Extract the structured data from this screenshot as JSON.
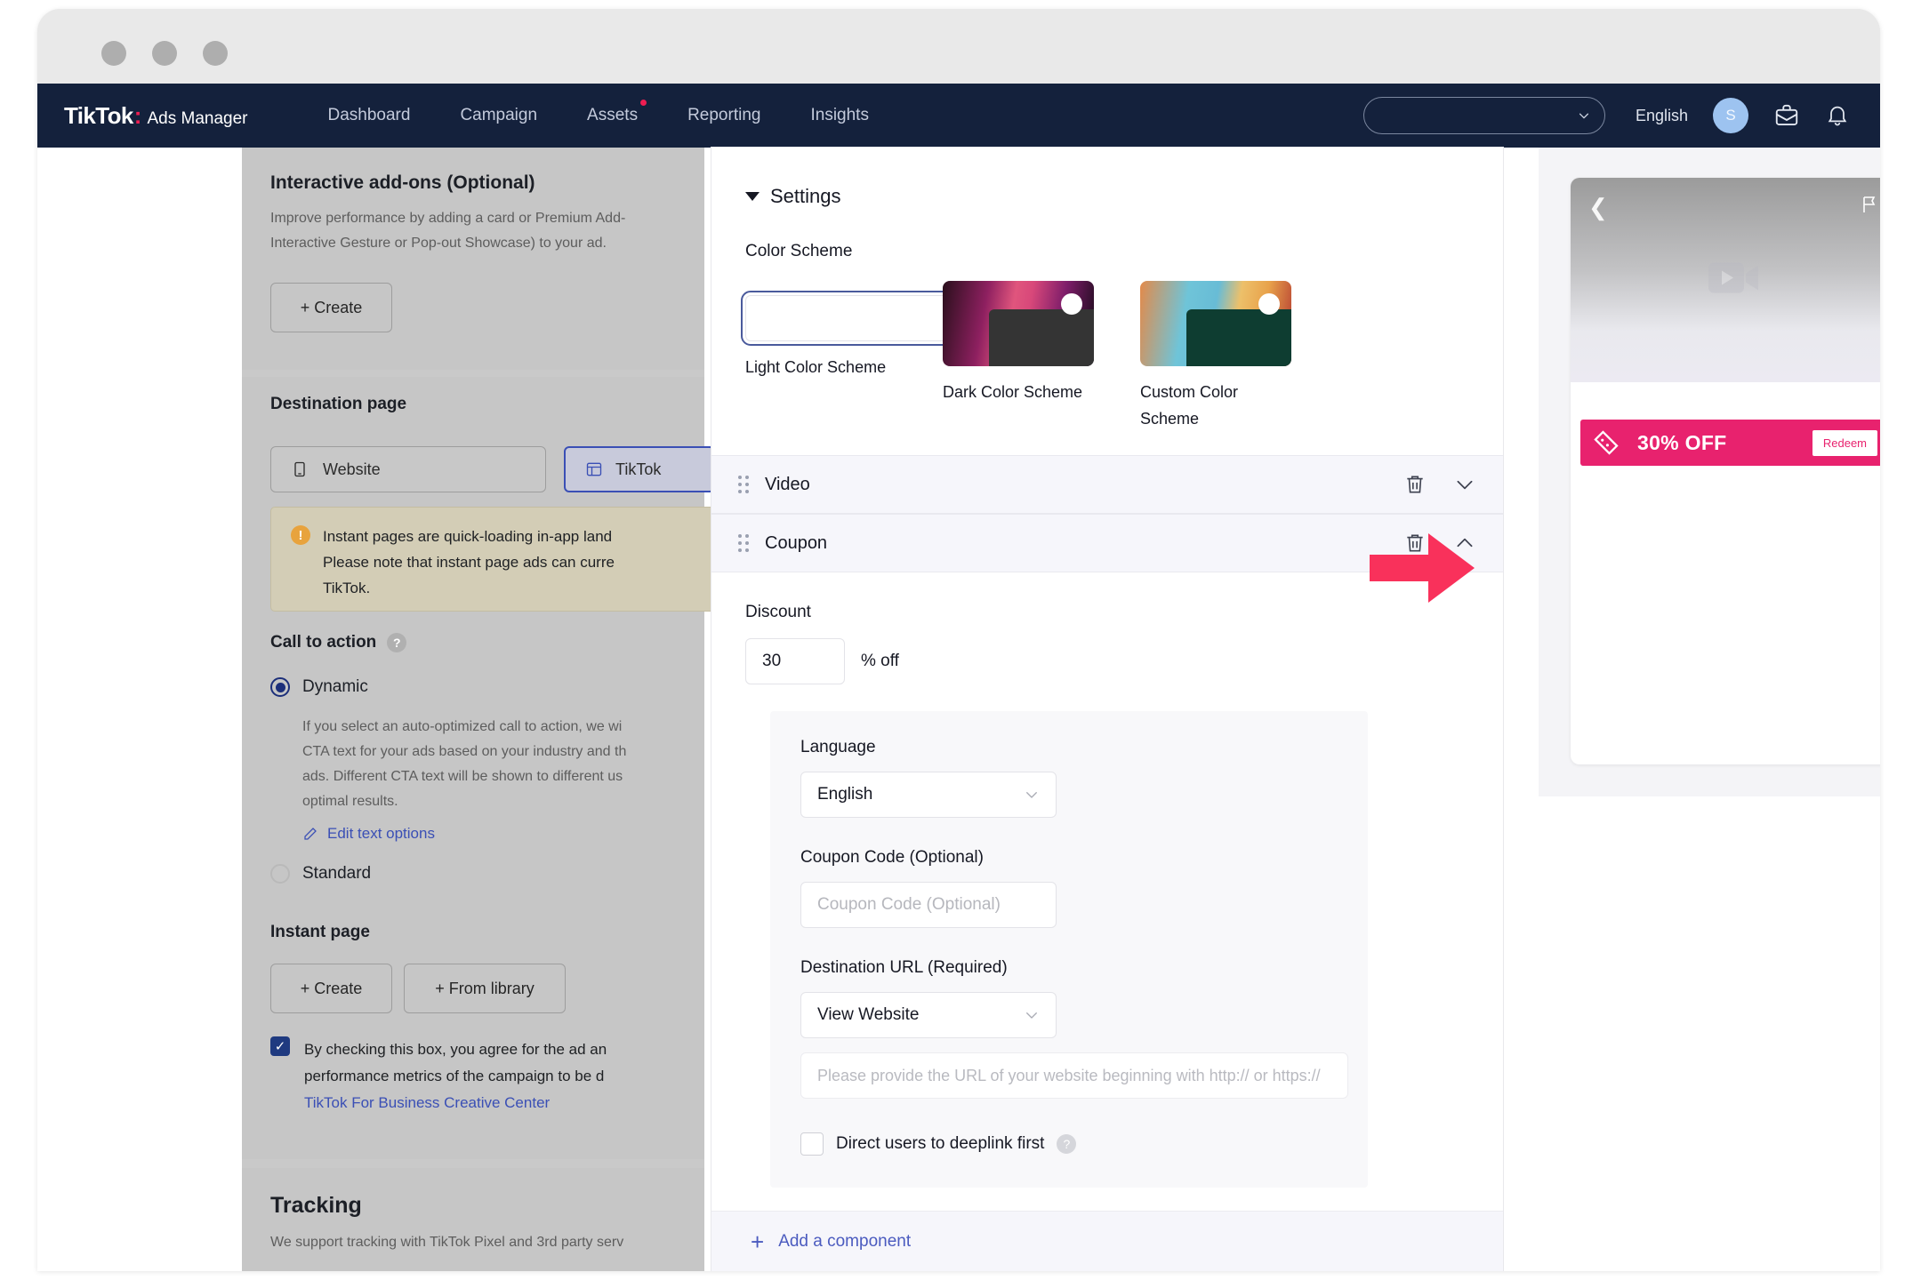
{
  "window": {
    "dots": [
      "close",
      "minimize",
      "maximize"
    ]
  },
  "nav": {
    "brand_name": "TikTok",
    "brand_colon": ":",
    "brand_suffix": "Ads Manager",
    "links": [
      {
        "label": "Dashboard",
        "badge": false
      },
      {
        "label": "Campaign",
        "badge": false
      },
      {
        "label": "Assets",
        "badge": true
      },
      {
        "label": "Reporting",
        "badge": false
      },
      {
        "label": "Insights",
        "badge": false
      }
    ],
    "account_selector_value": "",
    "language": "English",
    "avatar_initial": "S",
    "icons": [
      "chevron-down-icon",
      "briefcase-icon",
      "bell-icon"
    ]
  },
  "left_form": {
    "addons_title": "Interactive add-ons (Optional)",
    "addons_desc_line1": "Improve performance by adding a card or Premium Add-",
    "addons_desc_line2": "Interactive Gesture or Pop-out Showcase) to your ad.",
    "addons_create": "+ Create",
    "destination_title": "Destination page",
    "dest_website": "Website",
    "dest_tiktok": "TikTok",
    "alert_line1": "Instant pages are quick-loading in-app land",
    "alert_line2": "Please note that instant page ads can curre",
    "alert_line3": "TikTok.",
    "cta_title": "Call to action",
    "cta_dynamic": "Dynamic",
    "cta_desc_line1": "If you select an auto-optimized call to action, we wi",
    "cta_desc_line2": "CTA text for your ads based on your industry and th",
    "cta_desc_line3": "ads. Different CTA text will be shown to different us",
    "cta_desc_line4": "optimal results.",
    "edit_text_options": "Edit text options",
    "cta_standard": "Standard",
    "instant_page_title": "Instant page",
    "instant_create": "+ Create",
    "instant_from_library": "+ From library",
    "consent_line1": "By checking this box, you agree for the ad an",
    "consent_line2": "performance metrics of the campaign to be d",
    "consent_link": "TikTok For Business Creative Center",
    "tracking_title": "Tracking",
    "tracking_desc": "We support tracking with TikTok Pixel and 3rd party serv"
  },
  "panel": {
    "settings_title": "Settings",
    "color_scheme_label": "Color Scheme",
    "schemes": [
      {
        "label": "Light Color Scheme",
        "selected": true,
        "key": "light"
      },
      {
        "label": "Dark Color Scheme",
        "selected": false,
        "key": "dark"
      },
      {
        "label": "Custom Color Scheme",
        "selected": false,
        "key": "custom"
      }
    ],
    "components": [
      {
        "title": "Video",
        "expanded": false
      },
      {
        "title": "Coupon",
        "expanded": true
      }
    ],
    "coupon": {
      "discount_label": "Discount",
      "discount_value": "30",
      "percent_off_suffix": "% off",
      "language_label": "Language",
      "language_value": "English",
      "coupon_code_label": "Coupon Code (Optional)",
      "coupon_code_placeholder": "Coupon Code (Optional)",
      "destination_url_label": "Destination URL (Required)",
      "destination_url_select": "View Website",
      "url_placeholder": "Please provide the URL of your website beginning with http:// or https://",
      "deeplink_label": "Direct users to deeplink first"
    },
    "add_component": "Add a component",
    "add_component_plus": "+"
  },
  "preview": {
    "coupon_text": "30% OFF",
    "redeem_label": "Redeem",
    "back_icon": "chevron-left-icon",
    "flag_icon": "flag-icon",
    "play_icon": "video-play-icon"
  },
  "annotation": {
    "arrow_color": "#f9315b",
    "arrow_icon": "right-arrow-annotation"
  }
}
